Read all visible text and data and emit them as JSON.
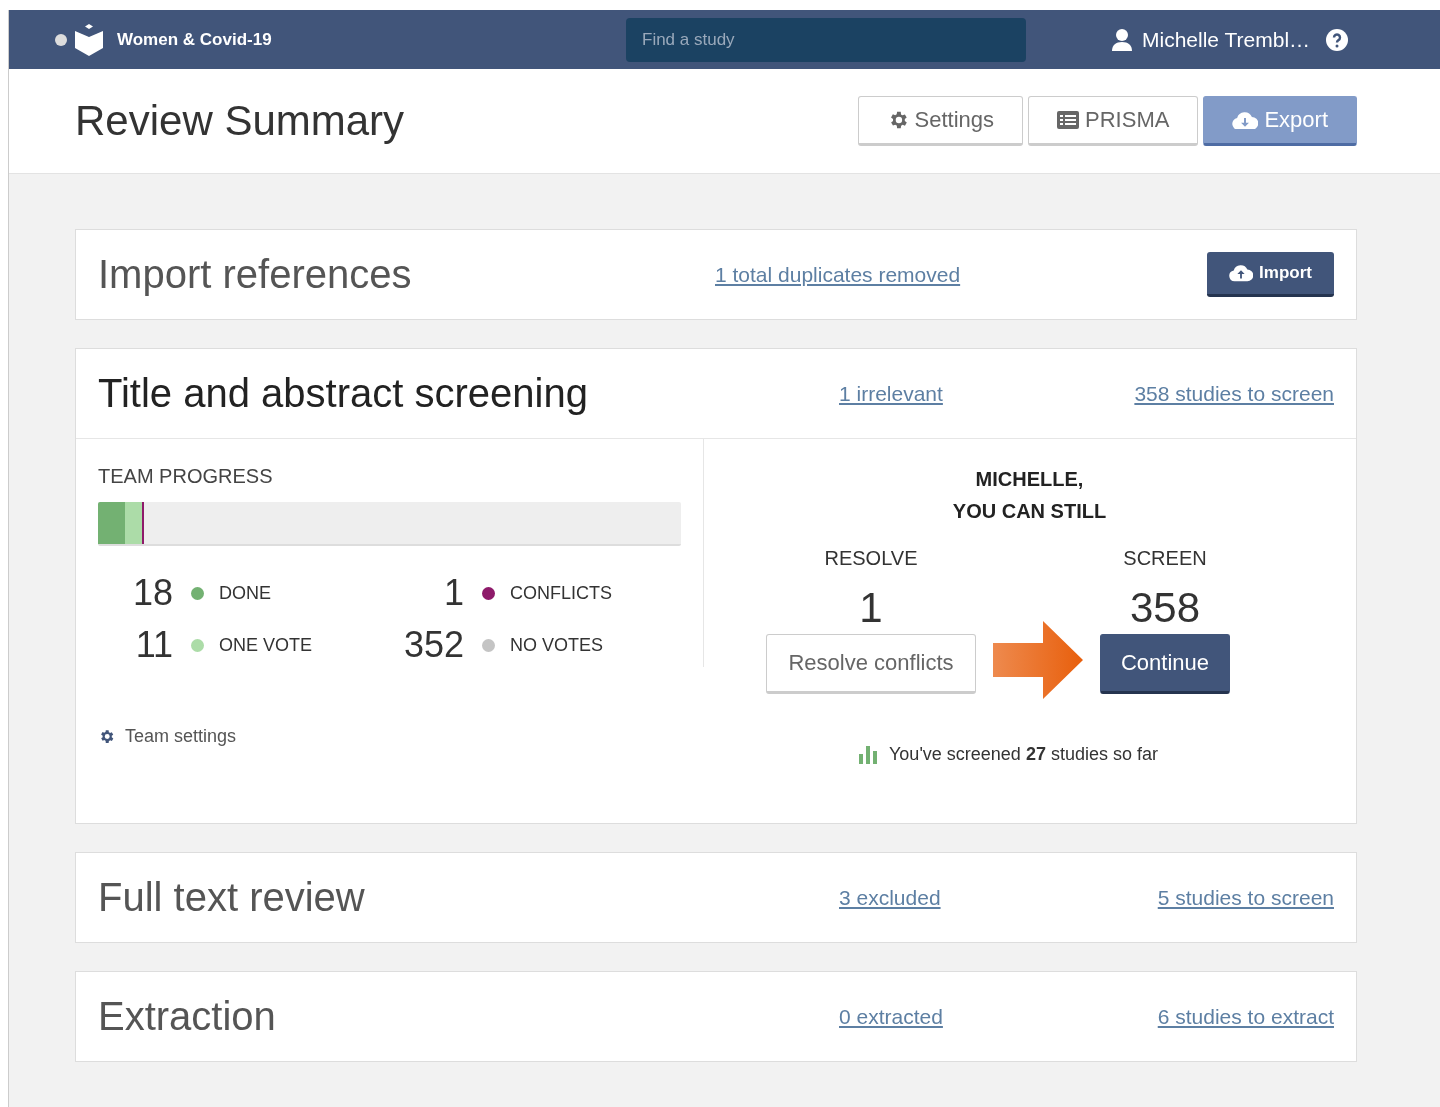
{
  "nav": {
    "project": "Women & Covid-19",
    "search": {
      "placeholder": "Find a study"
    },
    "user": "Michelle Trembl…"
  },
  "header": {
    "title": "Review Summary",
    "buttons": [
      {
        "label": "Settings",
        "kind": "settings"
      },
      {
        "label": "PRISMA",
        "kind": "prisma"
      },
      {
        "label": "Export",
        "kind": "export"
      }
    ]
  },
  "sections": [
    {
      "title": "Import references",
      "expanded": false,
      "links": [
        "1 total duplicates removed"
      ],
      "button": "Import"
    },
    {
      "title": "Title and abstract screening",
      "expanded": true,
      "links": [
        "1 irrelevant",
        "358 studies to screen"
      ],
      "progress": {
        "heading": "TEAM PROGRESS",
        "legend": [
          {
            "count": "18",
            "label": "DONE",
            "color": "#73b172",
            "kind": "segment",
            "level": 0.047
          },
          {
            "count": "1",
            "label": "CONFLICTS",
            "color": "#8e1a6a",
            "kind": "marker"
          },
          {
            "count": "11",
            "label": "ONE VOTE",
            "color": "#acdca8",
            "kind": "segment",
            "level": 0.029
          },
          {
            "count": "352",
            "label": "NO VOTES",
            "color": "#c4c4c4",
            "kind": "rest"
          }
        ],
        "settings_link": "Team settings"
      },
      "actions": {
        "heading": [
          "MICHELLE,",
          "YOU CAN STILL"
        ],
        "items": [
          {
            "label": "RESOLVE",
            "count": "1",
            "button": "Resolve conflicts",
            "kind": "secondary"
          },
          {
            "label": "SCREEN",
            "count": "358",
            "button": "Continue",
            "kind": "primary"
          }
        ],
        "note": "You've screened **27** studies so far"
      }
    },
    {
      "title": "Full text review",
      "expanded": false,
      "links": [
        "3 excluded",
        "5 studies to screen"
      ]
    },
    {
      "title": "Extraction",
      "expanded": false,
      "links": [
        "0 extracted",
        "6 studies to extract"
      ]
    }
  ]
}
